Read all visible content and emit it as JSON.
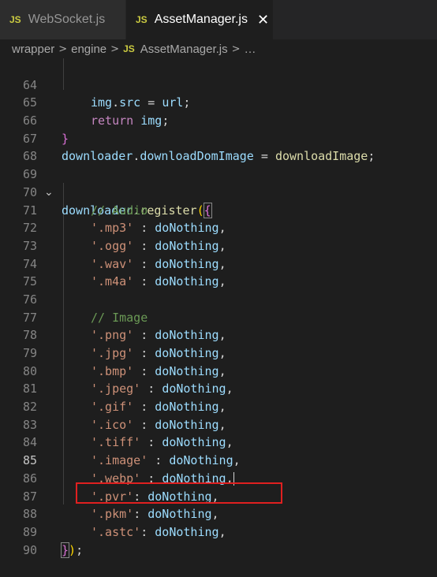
{
  "tabs": [
    {
      "badge": "JS",
      "label": "WebSocket.js"
    },
    {
      "badge": "JS",
      "label": "AssetManager.js",
      "close": "✕"
    }
  ],
  "breadcrumb": {
    "parts": [
      "wrapper",
      "engine"
    ],
    "badge": "JS",
    "file": "AssetManager.js",
    "more": "…"
  },
  "lines": {
    "64": {
      "num": "64",
      "a": "img",
      "b": ".",
      "c": "src",
      "d": " = ",
      "e": "url",
      "f": ";"
    },
    "65": {
      "num": "65",
      "a": "return",
      "b": " ",
      "c": "img",
      "d": ";"
    },
    "66": {
      "num": "66",
      "a": "}"
    },
    "67": {
      "num": "67",
      "a": "downloader",
      "b": ".",
      "c": "downloadDomImage",
      "d": " = ",
      "e": "downloadImage",
      "f": ";"
    },
    "68": {
      "num": "68"
    },
    "69": {
      "num": "69",
      "a": "downloader",
      "b": ".",
      "c": "register",
      "d": "(",
      "e": "{"
    },
    "70": {
      "num": "70",
      "a": "// Audio"
    },
    "71": {
      "num": "71",
      "a": "'.mp3'",
      "b": " : ",
      "c": "doNothing",
      "d": ","
    },
    "72": {
      "num": "72",
      "a": "'.ogg'",
      "b": " : ",
      "c": "doNothing",
      "d": ","
    },
    "73": {
      "num": "73",
      "a": "'.wav'",
      "b": " : ",
      "c": "doNothing",
      "d": ","
    },
    "74": {
      "num": "74",
      "a": "'.m4a'",
      "b": " : ",
      "c": "doNothing",
      "d": ","
    },
    "75": {
      "num": "75"
    },
    "76": {
      "num": "76",
      "a": "// Image"
    },
    "77": {
      "num": "77",
      "a": "'.png'",
      "b": " : ",
      "c": "doNothing",
      "d": ","
    },
    "78": {
      "num": "78",
      "a": "'.jpg'",
      "b": " : ",
      "c": "doNothing",
      "d": ","
    },
    "79": {
      "num": "79",
      "a": "'.bmp'",
      "b": " : ",
      "c": "doNothing",
      "d": ","
    },
    "80": {
      "num": "80",
      "a": "'.jpeg'",
      "b": " : ",
      "c": "doNothing",
      "d": ","
    },
    "81": {
      "num": "81",
      "a": "'.gif'",
      "b": " : ",
      "c": "doNothing",
      "d": ","
    },
    "82": {
      "num": "82",
      "a": "'.ico'",
      "b": " : ",
      "c": "doNothing",
      "d": ","
    },
    "83": {
      "num": "83",
      "a": "'.tiff'",
      "b": " : ",
      "c": "doNothing",
      "d": ","
    },
    "84": {
      "num": "84",
      "a": "'.image'",
      "b": " : ",
      "c": "doNothing",
      "d": ","
    },
    "85": {
      "num": "85",
      "a": "'.webp'",
      "b": " : ",
      "c": "doNothing",
      "d": ","
    },
    "86": {
      "num": "86",
      "a": "'.pvr'",
      "b": ": ",
      "c": "doNothing",
      "d": ","
    },
    "87": {
      "num": "87",
      "a": "'.pkm'",
      "b": ": ",
      "c": "doNothing",
      "d": ","
    },
    "88": {
      "num": "88",
      "a": "'.astc'",
      "b": ": ",
      "c": "doNothing",
      "d": ","
    },
    "89": {
      "num": "89",
      "a": "}",
      "b": ")",
      "c": ";"
    },
    "90": {
      "num": "90"
    }
  },
  "colors": {
    "highlight_box": "#e02020",
    "string": "#ce9178",
    "function": "#dcdcaa",
    "variable": "#9cdcfe",
    "comment": "#6a9955"
  },
  "icons": {
    "fold": "chevron-down-icon",
    "close": "close-icon"
  }
}
